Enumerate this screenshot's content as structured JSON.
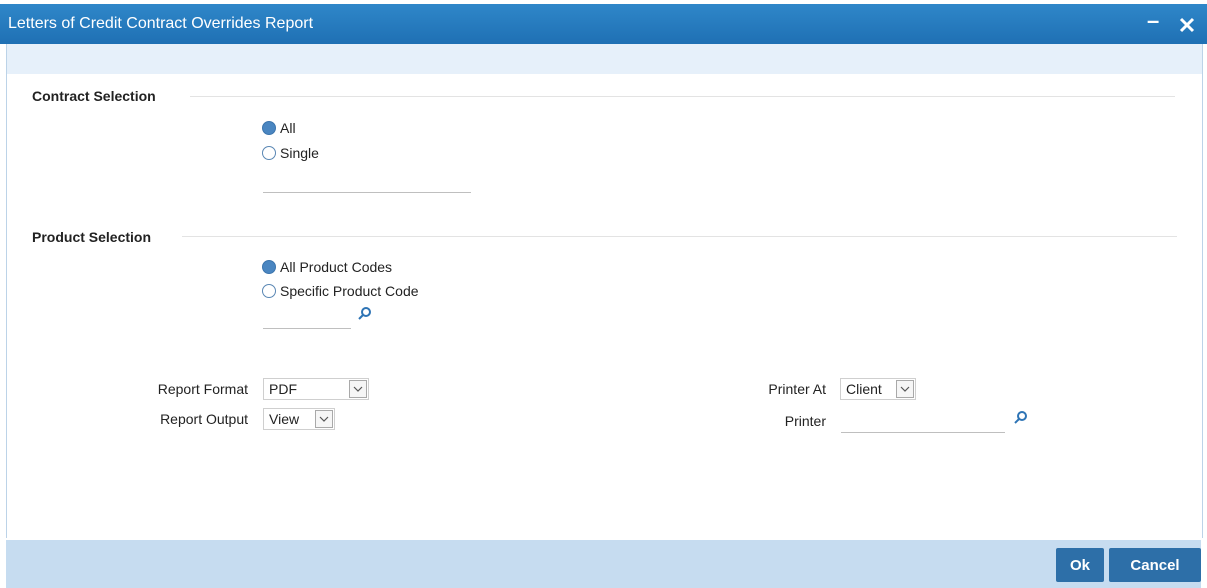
{
  "window": {
    "title": "Letters of Credit Contract Overrides Report",
    "minimize_icon": "minus-icon",
    "close_icon": "close-icon"
  },
  "contract_selection": {
    "heading": "Contract Selection",
    "options": [
      {
        "label": "All",
        "checked": true
      },
      {
        "label": "Single",
        "checked": false
      }
    ],
    "contract_ref_value": ""
  },
  "product_selection": {
    "heading": "Product Selection",
    "options": [
      {
        "label": "All Product Codes",
        "checked": true
      },
      {
        "label": "Specific Product Code",
        "checked": false
      }
    ],
    "product_code_value": "",
    "lookup_icon": "search-icon"
  },
  "report": {
    "format_label": "Report Format",
    "format_value": "PDF",
    "output_label": "Report Output",
    "output_value": "View",
    "printer_at_label": "Printer At",
    "printer_at_value": "Client",
    "printer_label": "Printer",
    "printer_value": "",
    "printer_lookup_icon": "search-icon"
  },
  "buttons": {
    "ok": "Ok",
    "cancel": "Cancel"
  },
  "colors": {
    "title_bar": "#1f70b4",
    "footer": "#c6dcf0",
    "button": "#2d6fa8",
    "radio_selected": "#4a86c1"
  }
}
